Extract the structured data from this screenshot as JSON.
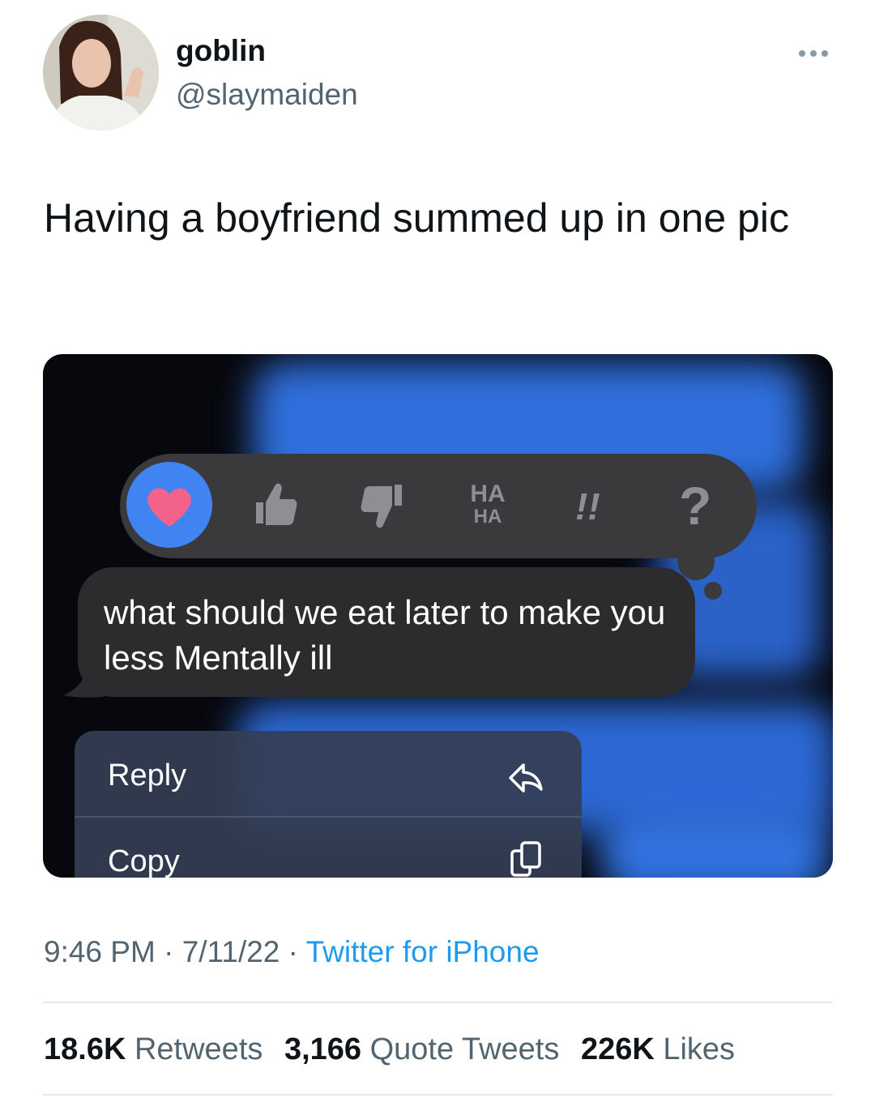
{
  "author": {
    "name": "goblin",
    "handle": "@slaymaiden"
  },
  "tweet": {
    "text": "Having a boyfriend summed up in one pic"
  },
  "media": {
    "reactions": [
      {
        "icon": "heart-icon",
        "selected": true
      },
      {
        "icon": "thumbs-up-icon"
      },
      {
        "icon": "thumbs-down-icon"
      },
      {
        "icon": "haha-icon",
        "line1": "HA",
        "line2": "HA"
      },
      {
        "icon": "exclamation-icon",
        "label": "!!"
      },
      {
        "icon": "question-icon",
        "label": "?"
      }
    ],
    "message": "what should we eat later to make you less Mentally ill",
    "menu": [
      {
        "label": "Reply",
        "icon": "reply-icon"
      },
      {
        "label": "Copy",
        "icon": "copy-icon"
      }
    ],
    "colors": {
      "accent": "#3f84f1",
      "heart": "#f2628a"
    }
  },
  "meta": {
    "time": "9:46 PM",
    "date": "7/11/22",
    "separator": "·",
    "source": "Twitter for iPhone"
  },
  "stats": {
    "retweets": {
      "count": "18.6K",
      "label": "Retweets"
    },
    "quotes": {
      "count": "3,166",
      "label": "Quote Tweets"
    },
    "likes": {
      "count": "226K",
      "label": "Likes"
    }
  }
}
